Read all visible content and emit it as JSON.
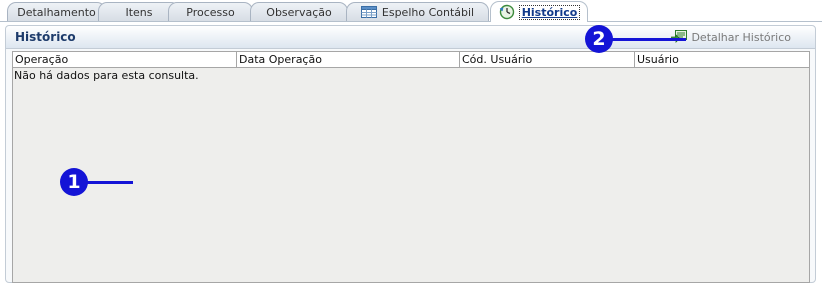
{
  "tabs": [
    {
      "label": "Detalhamento",
      "icon": null,
      "active": false
    },
    {
      "label": "Itens",
      "icon": null,
      "active": false
    },
    {
      "label": "Processo",
      "icon": null,
      "active": false
    },
    {
      "label": "Observação",
      "icon": null,
      "active": false
    },
    {
      "label": "Espelho Contábil",
      "icon": "table-icon",
      "active": false
    },
    {
      "label": "Histórico",
      "icon": "history-clock-icon",
      "active": true
    }
  ],
  "panel": {
    "title": "Histórico",
    "detail_action": {
      "label": "Detalhar Histórico",
      "icon": "detail-export-icon"
    }
  },
  "grid": {
    "columns": [
      "Operação",
      "Data Operação",
      "Cód. Usuário",
      "Usuário"
    ],
    "rows": [],
    "empty_message": "Não há dados para esta consulta."
  },
  "annotations": [
    {
      "number": "1"
    },
    {
      "number": "2"
    }
  ],
  "colors": {
    "accent": "#1414d6",
    "title": "#1d3b6b",
    "grid_bg": "#eeeeec"
  }
}
